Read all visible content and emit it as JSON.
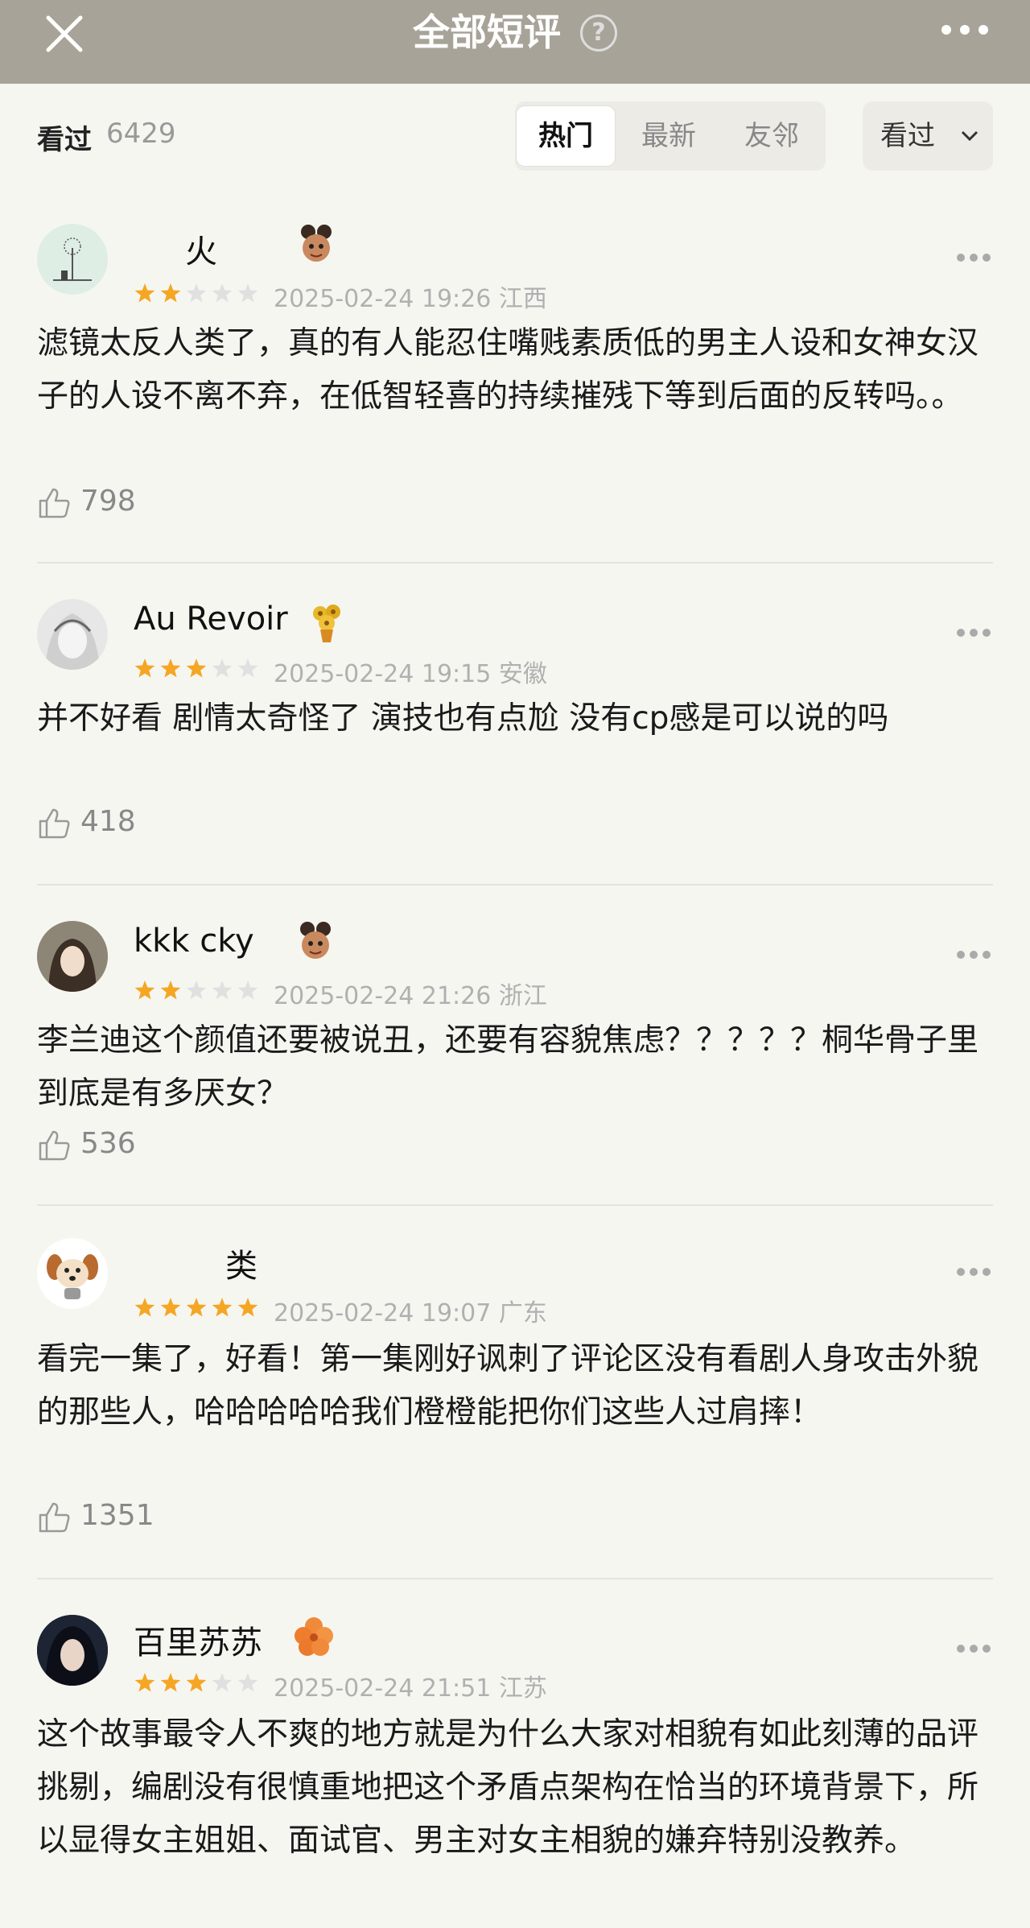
{
  "header": {
    "title": "全部短评",
    "help_glyph": "?"
  },
  "filter": {
    "seen_label": "看过",
    "seen_count": "6429",
    "tabs": [
      {
        "label": "热门",
        "active": true
      },
      {
        "label": "最新",
        "active": false
      },
      {
        "label": "友邻",
        "active": false
      }
    ],
    "dropdown_label": "看过"
  },
  "colors": {
    "topbar": "#a8a398",
    "star_filled": "#f5a623",
    "star_empty": "#e0e0e0",
    "background": "#f6f6f1"
  },
  "reviews": [
    {
      "username": "火",
      "badge_icon": "nezha-badge-icon",
      "rating": 2,
      "time": "2025-02-24 19:26",
      "location": "江西",
      "text": "滤镜太反人类了，真的有人能忍住嘴贱素质低的男主人设和女神女汉子的人设不离不弃，在低智轻喜的持续摧残下等到后面的反转吗。。",
      "likes": "798"
    },
    {
      "username": "Au Revoir",
      "badge_icon": "sunflower-badge-icon",
      "rating": 3,
      "time": "2025-02-24 19:15",
      "location": "安徽",
      "text": "并不好看 剧情太奇怪了 演技也有点尬 没有cp感是可以说的吗",
      "likes": "418"
    },
    {
      "username": "kkk cky",
      "badge_icon": "nezha-badge-icon",
      "rating": 2,
      "time": "2025-02-24 21:26",
      "location": "浙江",
      "text": "李兰迪这个颜值还要被说丑，还要有容貌焦虑？？？？？桐华骨子里到底是有多厌女？",
      "likes": "536"
    },
    {
      "username": "类",
      "badge_icon": "",
      "rating": 5,
      "time": "2025-02-24 19:07",
      "location": "广东",
      "text": "看完一集了，好看！第一集刚好讽刺了评论区没有看剧人身攻击外貌的那些人，哈哈哈哈哈我们橙橙能把你们这些人过肩摔！",
      "likes": "1351"
    },
    {
      "username": "百里苏苏",
      "badge_icon": "hibiscus-badge-icon",
      "rating": 3,
      "time": "2025-02-24 21:51",
      "location": "江苏",
      "text": "这个故事最令人不爽的地方就是为什么大家对相貌有如此刻薄的品评挑剔，编剧没有很慎重地把这个矛盾点架构在恰当的环境背景下，所以显得女主姐姐、面试官、男主对女主相貌的嫌弃特别没教养。",
      "likes": ""
    }
  ]
}
